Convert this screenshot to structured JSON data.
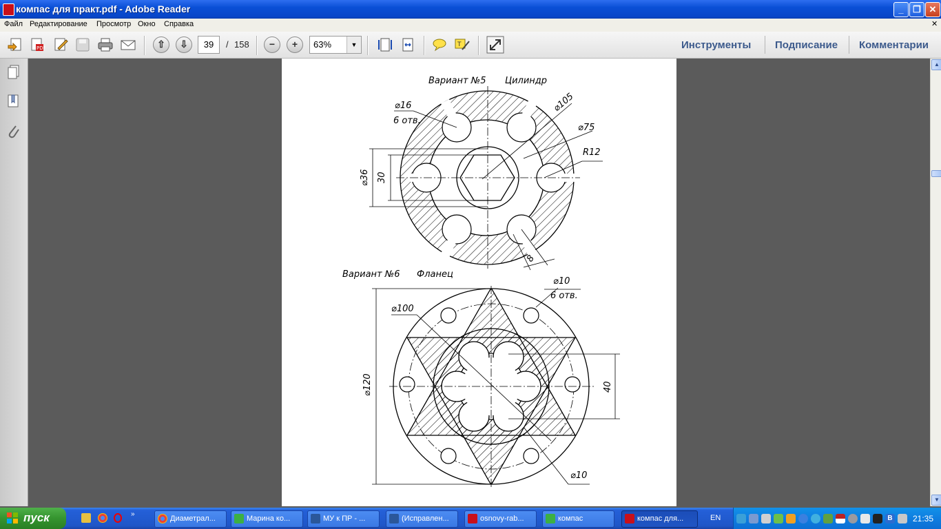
{
  "window": {
    "title": "компас для практ.pdf - Adobe Reader",
    "minimize": "_",
    "maximize": "❐",
    "close": "✕"
  },
  "menu": [
    "Файл",
    "Редактирование",
    "Просмотр",
    "Окно",
    "Справка"
  ],
  "toolbar": {
    "current_page": "39",
    "page_separator": "/",
    "total_pages": "158",
    "zoom": "63%",
    "zoom_out": "−",
    "zoom_in": "+",
    "right_links": [
      "Инструменты",
      "Подписание",
      "Комментарии"
    ]
  },
  "drawing": {
    "variant5_title": "Вариант №5",
    "variant5_name": "Цилиндр",
    "v5_hole_dia": "⌀16",
    "v5_hole_count": "6 отв.",
    "v5_outer_dia": "⌀105",
    "v5_mid_dia": "⌀75",
    "v5_radius": "R12",
    "v5_hex_dia": "⌀36",
    "v5_hex_flat": "30",
    "v5_slot_width": "8",
    "variant6_title": "Вариант №6",
    "variant6_name": "Фланец",
    "v6_hole_dia": "⌀10",
    "v6_hole_count": "6 отв.",
    "v6_pcd": "⌀100",
    "v6_outer_dia": "⌀120",
    "v6_inner_dim": "40",
    "v6_bottom_dia": "⌀10"
  },
  "taskbar": {
    "start_label": "пуск",
    "tasks": [
      "Диаметрал...",
      "Марина ко...",
      "МУ к ПР - ...",
      "(Исправлен...",
      "osnovy-rab...",
      "компас",
      "компас для..."
    ],
    "language": "EN",
    "clock": "21:35"
  }
}
